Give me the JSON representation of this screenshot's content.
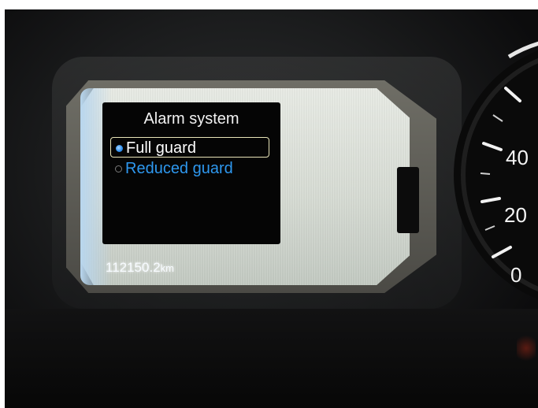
{
  "menu": {
    "title": "Alarm system",
    "options": [
      {
        "label": "Full guard",
        "selected": true
      },
      {
        "label": "Reduced guard",
        "selected": false
      }
    ]
  },
  "odometer": {
    "value": "112150.2",
    "unit": "km"
  },
  "speedometer": {
    "tick_labels": [
      "40",
      "20",
      "0"
    ]
  },
  "colors": {
    "selected_text": "#ffffff",
    "unselected_text": "#2e98ef",
    "highlight_border": "#e8e4b8",
    "panel_background": "#050505",
    "lcd_background": "#e4e8e1"
  }
}
